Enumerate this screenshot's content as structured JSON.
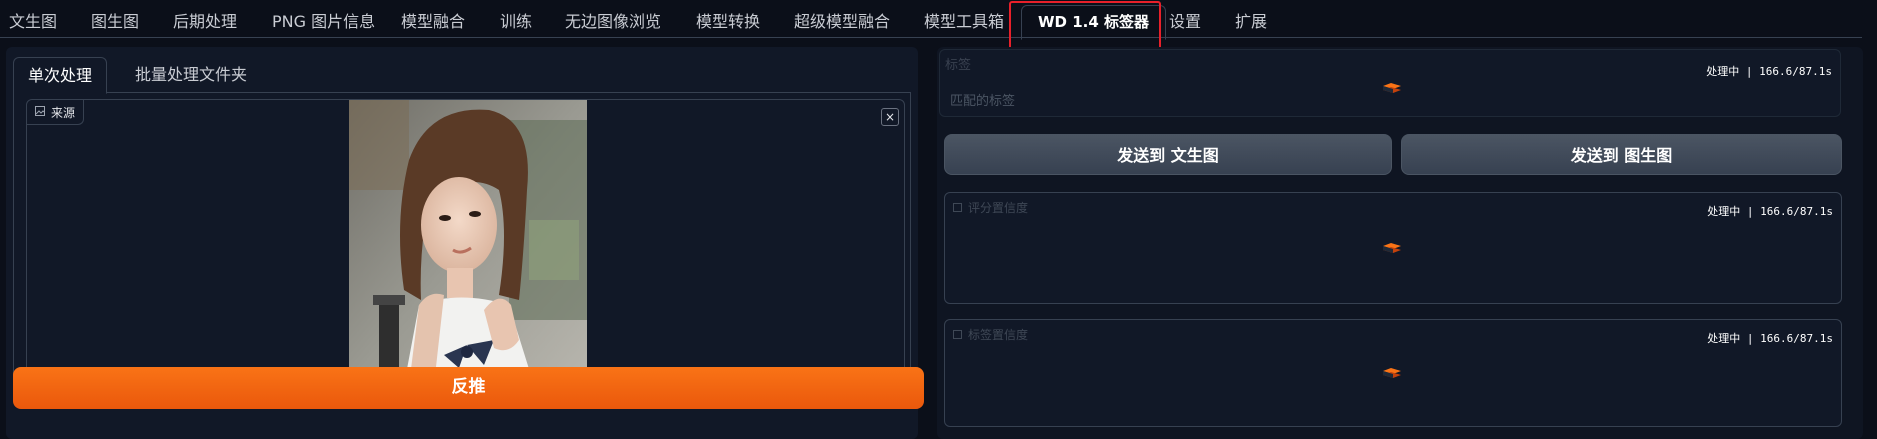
{
  "top_tabs": [
    "文生图",
    "图生图",
    "后期处理",
    "PNG 图片信息",
    "模型融合",
    "训练",
    "无边图像浏览",
    "模型转换",
    "超级模型融合",
    "模型工具箱",
    "WD 1.4 标签器",
    "设置",
    "扩展"
  ],
  "active_tab": "WD 1.4 标签器",
  "left": {
    "subtabs": [
      "单次处理",
      "批量处理文件夹"
    ],
    "source_label": "来源",
    "close_symbol": "×",
    "interrogate_button": "反推"
  },
  "right": {
    "tags_label": "标签",
    "tags_placeholder": "匹配的标签",
    "status_text": "处理中 | 166.6/87.1s",
    "send_txt2img": "发送到 文生图",
    "send_img2img": "发送到 图生图",
    "rating_label": "评分置信度",
    "tag_conf_label": "标签置信度"
  },
  "colors": {
    "accent_orange": "#f97316",
    "highlight_red": "#e8202a",
    "background": "#0b0f19",
    "panel": "#111827"
  }
}
